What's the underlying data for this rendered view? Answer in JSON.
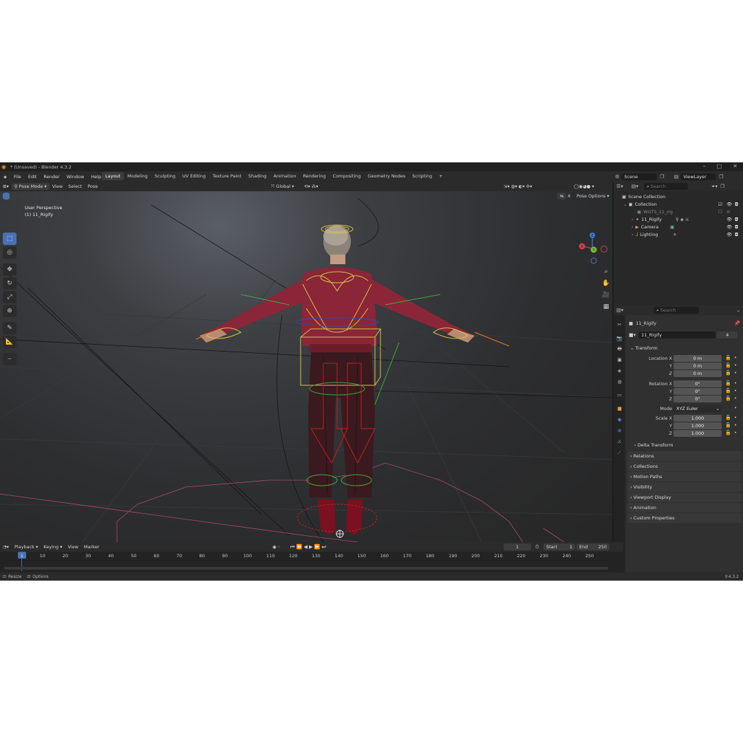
{
  "title": "* (Unsaved) - Blender 4.3.2",
  "menu": [
    "File",
    "Edit",
    "Render",
    "Window",
    "Help"
  ],
  "workspaces": [
    "Layout",
    "Modeling",
    "Sculpting",
    "UV Editing",
    "Texture Paint",
    "Shading",
    "Animation",
    "Rendering",
    "Compositing",
    "Geometry Nodes",
    "Scripting"
  ],
  "workspace_add": "+",
  "scene": "Scene",
  "view_layer": "ViewLayer",
  "viewport_header": {
    "mode": "Pose Mode",
    "menus": [
      "View",
      "Select",
      "Pose"
    ],
    "orientation": "Global",
    "pose_options": "Pose Options"
  },
  "viewport": {
    "perspective": "User Perspective",
    "object": "(1) 11_Rigify",
    "gizmo": {
      "x": "X",
      "y": "Y",
      "z": "Z"
    }
  },
  "outliner": {
    "search_placeholder": "Search",
    "items": [
      {
        "label": "Scene Collection"
      },
      {
        "label": "Collection"
      },
      {
        "label": "WGTS_11_rig"
      },
      {
        "label": "11_Rigify"
      },
      {
        "label": "Camera"
      },
      {
        "label": "Lighting"
      }
    ]
  },
  "properties": {
    "search_placeholder": "Search",
    "object_name": "11_Rigify",
    "data_name": "11_Rigify",
    "users": "4",
    "transform_label": "Transform",
    "location": {
      "label": "Location X",
      "x": "0 m",
      "y": "0 m",
      "z": "0 m"
    },
    "rotation": {
      "label": "Rotation X",
      "x": "0°",
      "y": "0°",
      "z": "0°"
    },
    "mode_label": "Mode",
    "mode_value": "XYZ Euler",
    "scale": {
      "label": "Scale X",
      "x": "1.000",
      "y": "1.000",
      "z": "1.000"
    },
    "axis_y": "Y",
    "axis_z": "Z",
    "panels": [
      "Delta Transform",
      "Relations",
      "Collections",
      "Motion Paths",
      "Visibility",
      "Viewport Display",
      "Animation",
      "Custom Properties"
    ]
  },
  "timeline": {
    "menus": [
      "Playback",
      "Keying",
      "View",
      "Marker"
    ],
    "current_frame": "1",
    "start_label": "Start",
    "start": "1",
    "end_label": "End",
    "end": "250",
    "ticks": [
      "1",
      "10",
      "20",
      "30",
      "40",
      "50",
      "60",
      "70",
      "80",
      "90",
      "100",
      "110",
      "120",
      "130",
      "140",
      "150",
      "160",
      "170",
      "180",
      "190",
      "200",
      "210",
      "220",
      "230",
      "240",
      "250"
    ]
  },
  "status": {
    "left1": "Resize",
    "left2": "Options",
    "version": "4.3.2"
  },
  "colors": {
    "accent": "#4772b3",
    "header": "#2b2b2b",
    "bg": "#1d1d1d"
  }
}
